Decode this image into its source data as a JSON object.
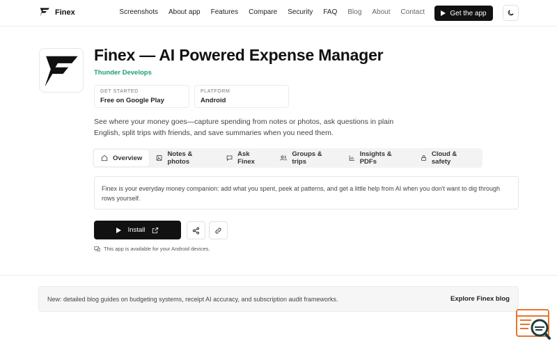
{
  "nav": {
    "brand": "Finex",
    "items": [
      "Screenshots",
      "About app",
      "Features",
      "Compare",
      "Security",
      "FAQ",
      "Blog",
      "About",
      "Contact"
    ],
    "cta_label": "Get the app"
  },
  "app": {
    "title": "Finex — AI Powered Expense Manager",
    "developer": "Thunder Develops",
    "cards": [
      {
        "label": "GET STARTED",
        "value": "Free on Google Play"
      },
      {
        "label": "PLATFORM",
        "value": "Android"
      }
    ],
    "description": "See where your money goes—capture spending from notes or photos, ask questions in plain English, split trips with friends, and save summaries when you need them."
  },
  "tabs": [
    {
      "label": "Overview",
      "icon": "home-icon"
    },
    {
      "label": "Notes & photos",
      "icon": "image-icon"
    },
    {
      "label": "Ask Finex",
      "icon": "chat-icon"
    },
    {
      "label": "Groups & trips",
      "icon": "users-icon"
    },
    {
      "label": "Insights & PDFs",
      "icon": "chart-icon"
    },
    {
      "label": "Cloud & safety",
      "icon": "lock-icon"
    }
  ],
  "panel_text": "Finex is your everyday money companion: add what you spent, peek at patterns, and get a little help from AI when you don't want to dig through rows yourself.",
  "actions": {
    "install_label": "Install",
    "note": "This app is available for your Android devices."
  },
  "banner": {
    "text": "New: detailed blog guides on budgeting systems, receipt AI accuracy, and subscription audit frameworks.",
    "link": "Explore Finex blog"
  },
  "colors": {
    "accent": "#1a9e6a",
    "dark": "#111111",
    "fab": "#e8742c"
  }
}
